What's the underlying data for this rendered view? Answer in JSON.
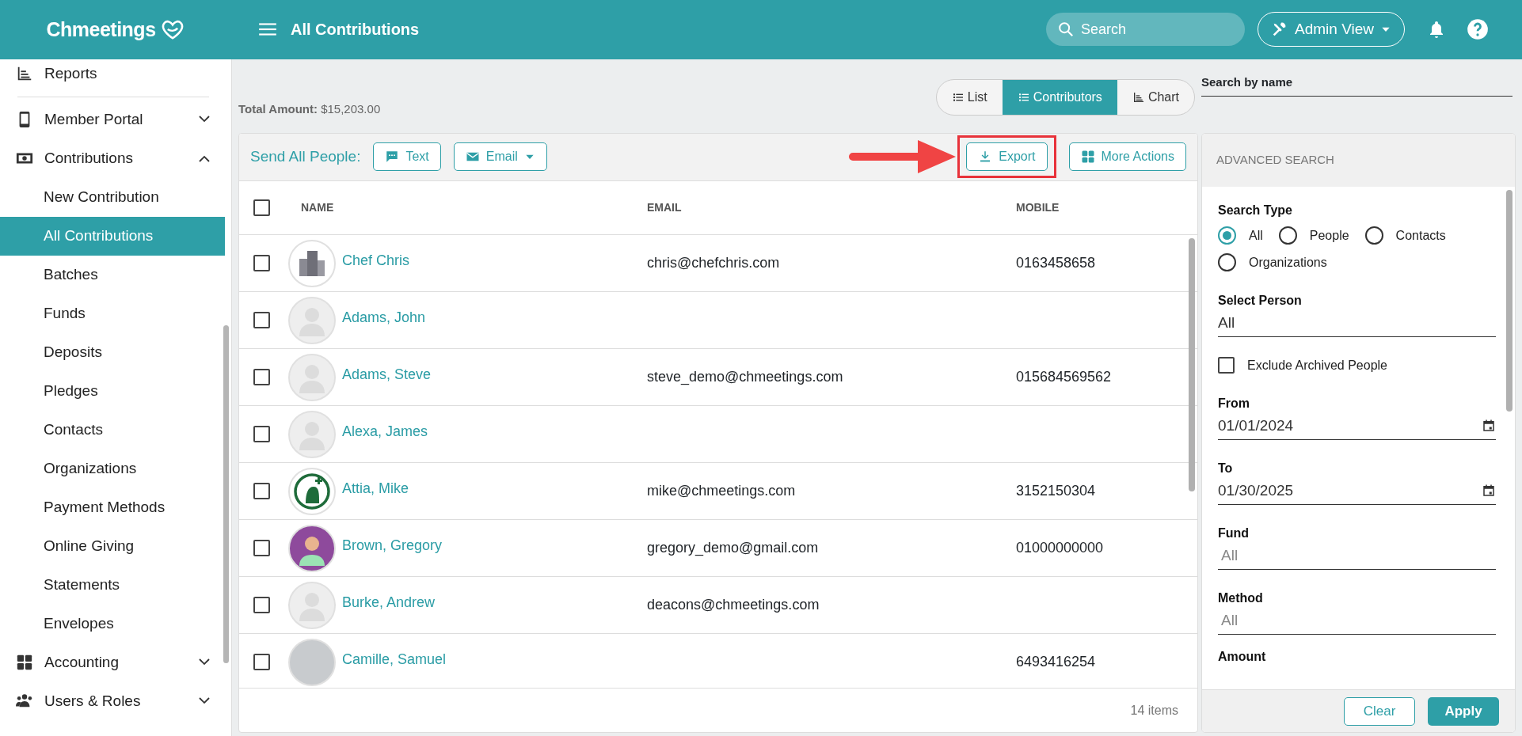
{
  "header": {
    "brand": "Chmeetings",
    "title": "All Contributions",
    "search": {
      "placeholder": "Search"
    },
    "admin_view": "Admin View"
  },
  "sidebar": {
    "items": [
      {
        "label": "Reports"
      },
      {
        "label": "Member Portal",
        "expanded": false
      },
      {
        "label": "Contributions",
        "expanded": true,
        "children": [
          {
            "label": "New Contribution",
            "selected": false
          },
          {
            "label": "All Contributions",
            "selected": true
          },
          {
            "label": "Batches",
            "selected": false
          },
          {
            "label": "Funds",
            "selected": false
          },
          {
            "label": "Deposits",
            "selected": false
          },
          {
            "label": "Pledges",
            "selected": false
          },
          {
            "label": "Contacts",
            "selected": false
          },
          {
            "label": "Organizations",
            "selected": false
          },
          {
            "label": "Payment Methods",
            "selected": false
          },
          {
            "label": "Online Giving",
            "selected": false
          },
          {
            "label": "Statements",
            "selected": false
          },
          {
            "label": "Envelopes",
            "selected": false
          }
        ]
      },
      {
        "label": "Accounting",
        "expanded": false
      },
      {
        "label": "Users & Roles",
        "expanded": false
      }
    ]
  },
  "summary": {
    "label": "Total Amount:",
    "value": "$15,203.00"
  },
  "view_tabs": [
    {
      "label": "List",
      "selected": false
    },
    {
      "label": "Contributors",
      "selected": true
    },
    {
      "label": "Chart",
      "selected": false
    }
  ],
  "toolbar": {
    "send_label": "Send All People:",
    "buttons": [
      {
        "label": "Text",
        "kind": "text",
        "highlighted": false
      },
      {
        "label": "Email",
        "kind": "email",
        "highlighted": false
      },
      {
        "label": "Export",
        "kind": "export",
        "highlighted": true
      },
      {
        "label": "More Actions",
        "kind": "more",
        "highlighted": false
      }
    ]
  },
  "table": {
    "select_all_checked": false,
    "columns": [
      "NAME",
      "EMAIL",
      "MOBILE"
    ],
    "rows": [
      {
        "name": "Chef Chris",
        "email": "chris@chefchris.com",
        "mobile": "0163458658",
        "kind": "building",
        "checked": false
      },
      {
        "name": "Adams, John",
        "kind": "placeholder",
        "checked": false
      },
      {
        "name": "Adams, Steve",
        "email": "steve_demo@chmeetings.com",
        "mobile": "015684569562",
        "kind": "placeholder",
        "checked": false
      },
      {
        "name": "Alexa, James",
        "kind": "placeholder",
        "checked": false
      },
      {
        "name": "Attia, Mike",
        "email": "mike@chmeetings.com",
        "mobile": "3152150304",
        "kind": "logo",
        "checked": false
      },
      {
        "name": "Brown, Gregory",
        "email": "gregory_demo@gmail.com",
        "mobile": "01000000000",
        "kind": "cartoon",
        "checked": false
      },
      {
        "name": "Burke, Andrew",
        "email": "deacons@chmeetings.com",
        "kind": "placeholder",
        "checked": false
      },
      {
        "name": "Camille, Samuel",
        "mobile": "6493416254",
        "kind": "photo",
        "checked": false
      }
    ],
    "footer": "14 items"
  },
  "search_by_name": {
    "label": "Search by name"
  },
  "advanced_search": {
    "title": "ADVANCED SEARCH",
    "search_type": {
      "label": "Search Type",
      "options": [
        {
          "label": "All",
          "selected": true
        },
        {
          "label": "People",
          "selected": false
        },
        {
          "label": "Contacts",
          "selected": false
        },
        {
          "label": "Organizations",
          "selected": false
        }
      ]
    },
    "fields": [
      {
        "kind": "select",
        "label": "Select Person",
        "value": "All"
      },
      {
        "kind": "checkbox",
        "label": "Exclude Archived People",
        "checked": false
      },
      {
        "kind": "date",
        "label": "From",
        "value": "01/01/2024"
      },
      {
        "kind": "date",
        "label": "To",
        "value": "01/30/2025"
      },
      {
        "kind": "select",
        "label": "Fund",
        "placeholder": "All"
      },
      {
        "kind": "select",
        "label": "Method",
        "placeholder": "All"
      },
      {
        "kind": "label",
        "label": "Amount"
      }
    ],
    "buttons": [
      {
        "label": "Clear",
        "kind": "outline"
      },
      {
        "label": "Apply",
        "kind": "solid"
      }
    ]
  }
}
